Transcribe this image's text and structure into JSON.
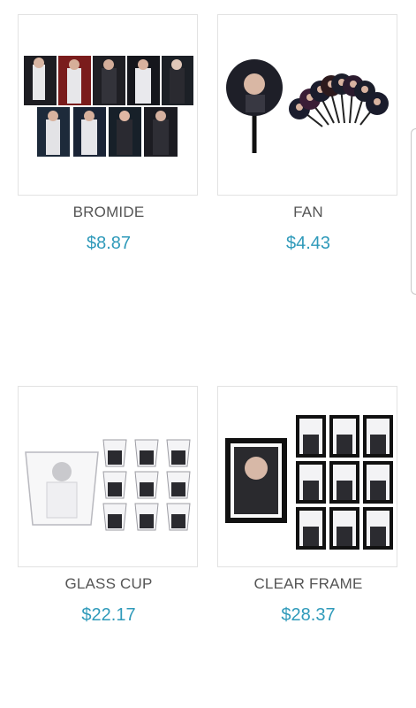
{
  "products": [
    {
      "name": "BROMIDE",
      "price": "$8.87",
      "image": "bromide-photo-set"
    },
    {
      "name": "FAN",
      "price": "$4.43",
      "image": "hand-fan-set"
    },
    {
      "name": "GLASS CUP",
      "price": "$22.17",
      "image": "glass-cup-set"
    },
    {
      "name": "CLEAR FRAME",
      "price": "$28.37",
      "image": "clear-frame-set"
    }
  ],
  "colors": {
    "price": "#2f9aba",
    "name": "#555555",
    "border": "#e2e2e2"
  }
}
